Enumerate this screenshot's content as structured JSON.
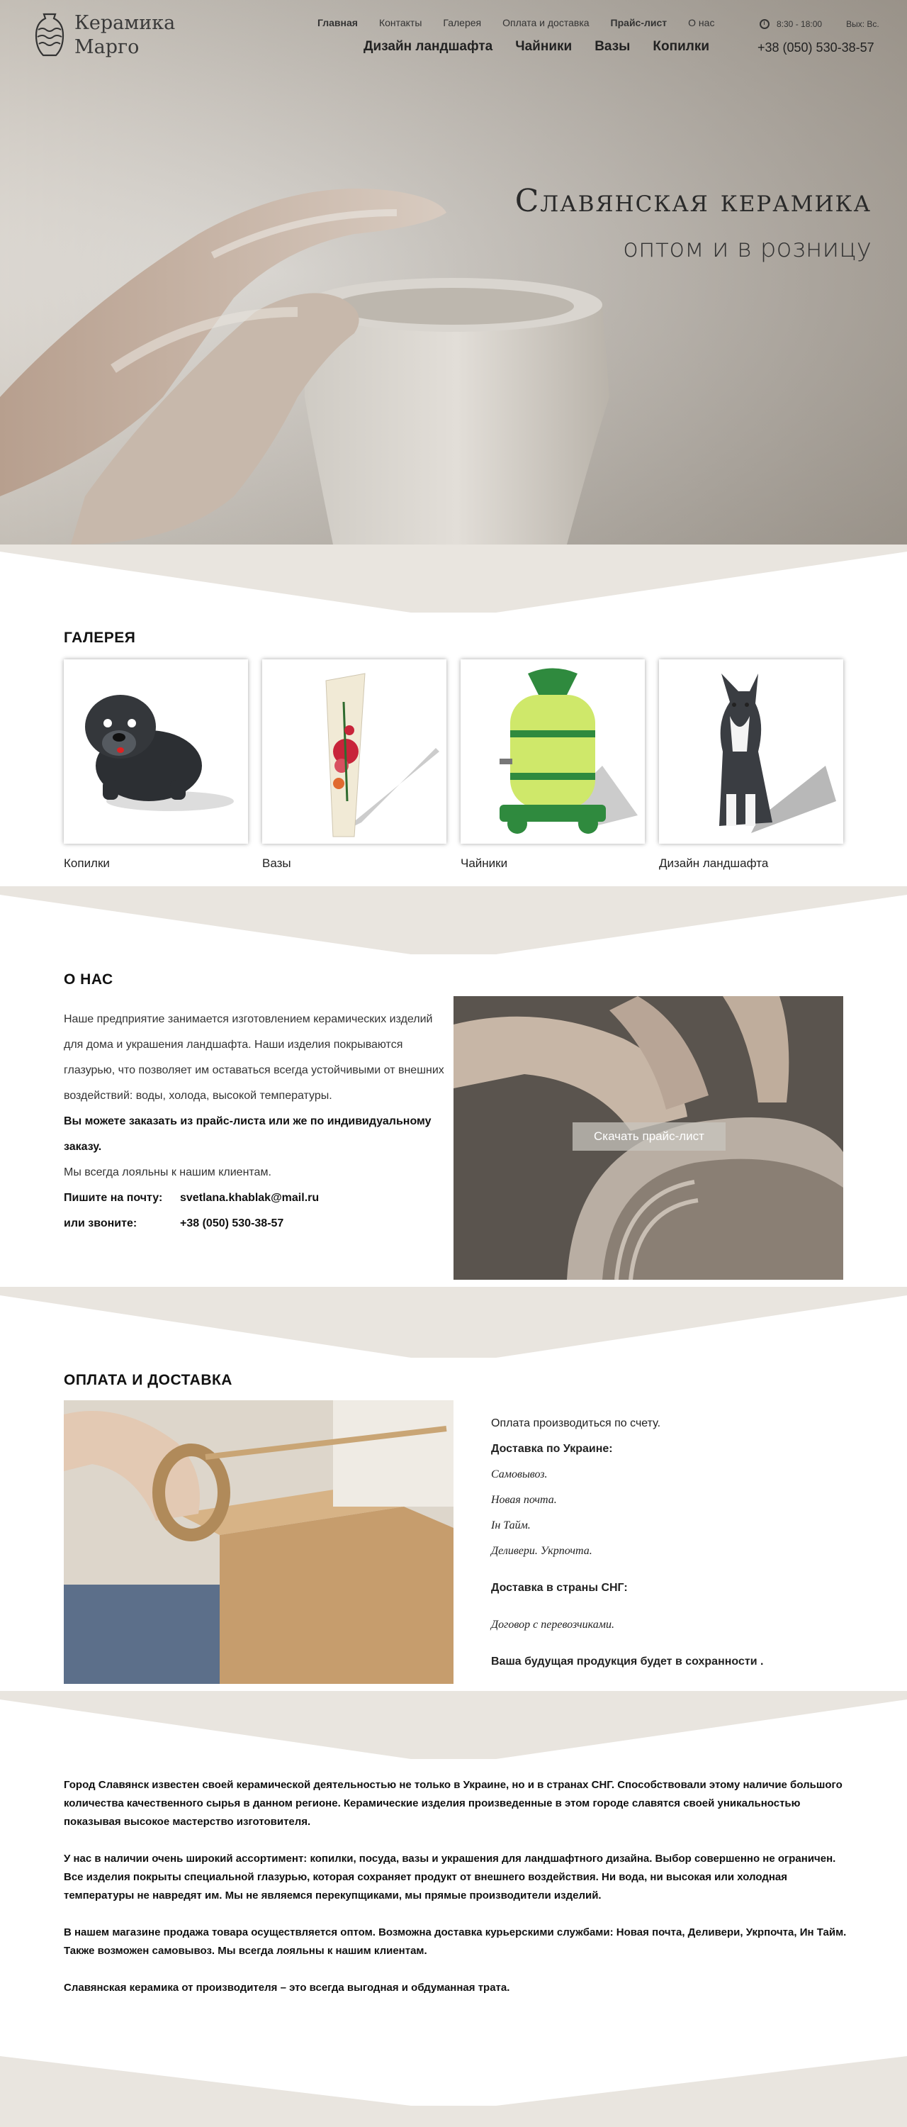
{
  "header": {
    "logo_line1": "Керамика",
    "logo_line2": "Марго",
    "top_nav": [
      {
        "label": "Главная",
        "bold": true
      },
      {
        "label": "Контакты",
        "bold": false
      },
      {
        "label": "Галерея",
        "bold": false
      },
      {
        "label": "Оплата и доставка",
        "bold": false
      },
      {
        "label": "Прайс-лист",
        "bold": true
      },
      {
        "label": "О нас",
        "bold": false
      }
    ],
    "main_nav": [
      "Дизайн ландшафта",
      "Чайники",
      "Вазы",
      "Копилки"
    ],
    "hours": "8:30 - 18:00",
    "days_off": "Вых: Вс.",
    "phone": "+38 (050) 530-38-57"
  },
  "hero": {
    "title": "Славянская керамика",
    "subtitle": "оптом и в розницу"
  },
  "gallery": {
    "heading": "ГАЛЕРЕЯ",
    "items": [
      {
        "label": "Копилки",
        "icon": "dog-piggybank-image"
      },
      {
        "label": "Вазы",
        "icon": "vase-image"
      },
      {
        "label": "Чайники",
        "icon": "barrel-teapot-image"
      },
      {
        "label": "Дизайн ландшафта",
        "icon": "husky-figurine-image"
      }
    ]
  },
  "about": {
    "heading": "О НАС",
    "paragraph": "Наше предприятие занимается изготовлением керамических изделий для дома и украшения ландшафта. Наши изделия покрываются глазурью, что позволяет  им оставаться всегда устойчивыми от внешних воздействий: воды, холода, высокой температуры.",
    "order_note": "Вы можете заказать из прайс-листа или же по индивидуальному заказу.",
    "loyal": "Мы всегда лояльны к нашим клиентам.",
    "mail_label": "Пишите на почту:",
    "mail_value": "svetlana.khablak@mail.ru",
    "call_label": "или звоните:",
    "call_value": "+38 (050) 530-38-57",
    "download_button": "Скачать прайс-лист"
  },
  "payment": {
    "heading": "ОПЛАТА И ДОСТАВКА",
    "lines": [
      {
        "text": "Оплата производиться по счету.",
        "style": "normal"
      },
      {
        "text": "Доставка по Украине:",
        "style": "bold"
      },
      {
        "text": "Самовывоз.",
        "style": "italic"
      },
      {
        "text": "Новая почта.",
        "style": "italic"
      },
      {
        "text": "Ін Тайм.",
        "style": "italic"
      },
      {
        "text": "Деливери. Укрпочта.",
        "style": "italic"
      },
      {
        "text": "",
        "style": "gap"
      },
      {
        "text": "Доставка в страны СНГ:",
        "style": "bold"
      },
      {
        "text": "",
        "style": "gap"
      },
      {
        "text": "Договор с перевозчиками.",
        "style": "italic"
      },
      {
        "text": "",
        "style": "gap"
      },
      {
        "text": "Ваша будущая продукция будет в сохранности .",
        "style": "bold"
      }
    ]
  },
  "seo": {
    "paragraphs": [
      "Город Славянск известен своей керамической деятельностью не только в Украине, но и в странах СНГ. Способствовали этому наличие большого количества качественного сырья в данном регионе. Керамические изделия произведенные в этом городе славятся своей уникальностью показывая высокое мастерство изготовителя.",
      "У нас в наличии очень широкий ассортимент: копилки, посуда, вазы и украшения для ландшафтного дизайна. Выбор совершенно не ограничен. Все изделия покрыты специальной глазурью, которая сохраняет продукт от внешнего воздействия. Ни вода, ни высокая или холодная температуры не навредят им. Мы не являемся перекупщиками, мы прямые производители изделий.",
      "В нашем магазине продажа товара осуществляется оптом. Возможна доставка курьерскими службами: Новая почта, Деливери, Укрпочта, Ин Тайм. Также возможен самовывоз. Мы всегда лояльны к нашим клиентам.",
      "Славянская керамика от производителя – это всегда выгодная и обдуманная трата."
    ]
  }
}
